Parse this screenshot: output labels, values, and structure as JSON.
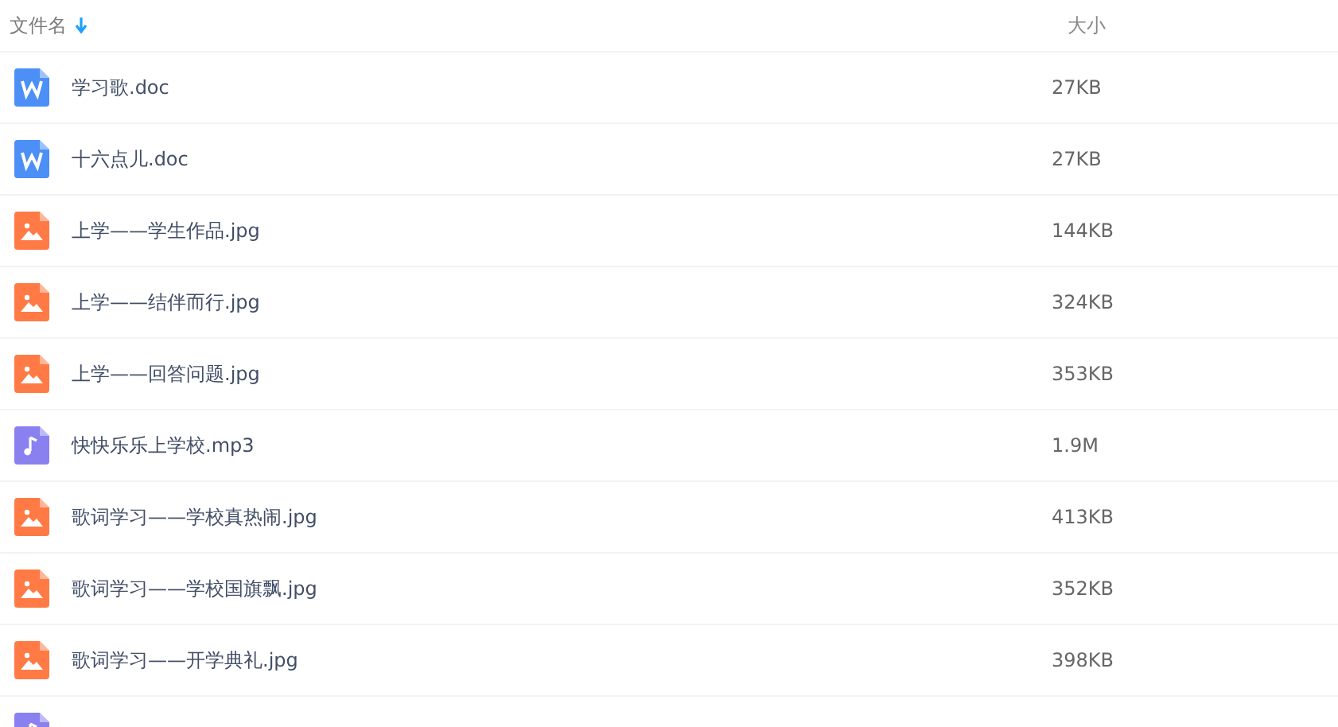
{
  "table": {
    "columns": [
      {
        "label": "文件名",
        "sorted": true
      },
      {
        "label": "大小",
        "sorted": false
      }
    ],
    "rows": [
      {
        "kind": "word",
        "name": "学习歌.doc",
        "size": "27KB"
      },
      {
        "kind": "word",
        "name": "十六点儿.doc",
        "size": "27KB"
      },
      {
        "kind": "image",
        "name": "上学——学生作品.jpg",
        "size": "144KB"
      },
      {
        "kind": "image",
        "name": "上学——结伴而行.jpg",
        "size": "324KB"
      },
      {
        "kind": "image",
        "name": "上学——回答问题.jpg",
        "size": "353KB"
      },
      {
        "kind": "audio",
        "name": "快快乐乐上学校.mp3",
        "size": "1.9M"
      },
      {
        "kind": "image",
        "name": "歌词学习——学校真热闹.jpg",
        "size": "413KB"
      },
      {
        "kind": "image",
        "name": "歌词学习——学校国旗飘.jpg",
        "size": "352KB"
      },
      {
        "kind": "image",
        "name": "歌词学习——开学典礼.jpg",
        "size": "398KB"
      },
      {
        "kind": "audio"
      }
    ]
  }
}
